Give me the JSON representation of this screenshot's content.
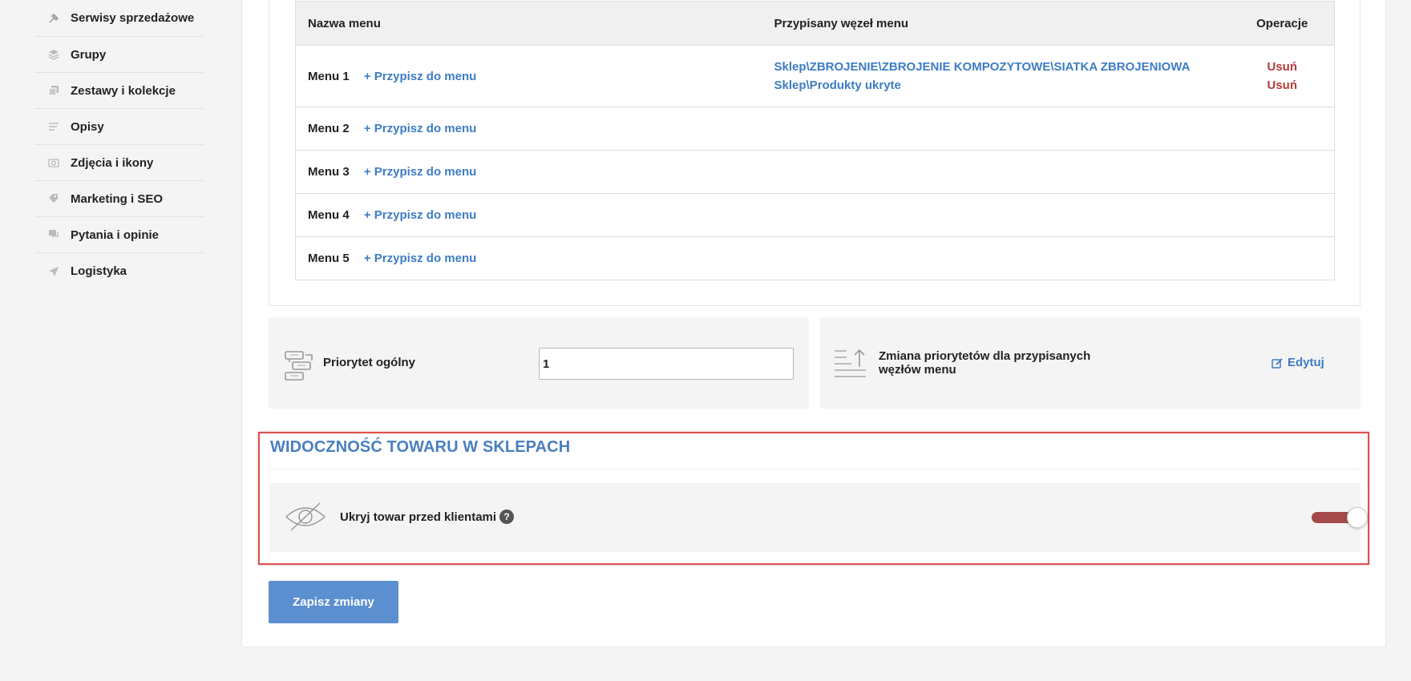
{
  "sidebar": {
    "items": [
      {
        "label": "Serwisy sprzedażowe",
        "icon": "hammer-icon"
      },
      {
        "label": "Grupy",
        "icon": "layers-icon"
      },
      {
        "label": "Zestawy i kolekcje",
        "icon": "stack-icon"
      },
      {
        "label": "Opisy",
        "icon": "text-icon"
      },
      {
        "label": "Zdjęcia i ikony",
        "icon": "camera-icon"
      },
      {
        "label": "Marketing i SEO",
        "icon": "tags-icon"
      },
      {
        "label": "Pytania i opinie",
        "icon": "comments-icon"
      },
      {
        "label": "Logistyka",
        "icon": "send-icon"
      }
    ]
  },
  "menu_table": {
    "headers": {
      "name": "Nazwa menu",
      "node": "Przypisany węzeł menu",
      "ops": "Operacje"
    },
    "rows": [
      {
        "name": "Menu 1",
        "assign": "+ Przypisz do menu",
        "nodes": [
          "Sklep\\ZBROJENIE\\ZBROJENIE KOMPOZYTOWE\\SIATKA ZBROJENIOWA",
          "Sklep\\Produkty ukryte"
        ],
        "ops": [
          "Usuń",
          "Usuń"
        ]
      },
      {
        "name": "Menu 2",
        "assign": "+ Przypisz do menu"
      },
      {
        "name": "Menu 3",
        "assign": "+ Przypisz do menu"
      },
      {
        "name": "Menu 4",
        "assign": "+ Przypisz do menu"
      },
      {
        "name": "Menu 5",
        "assign": "+ Przypisz do menu"
      }
    ]
  },
  "priority": {
    "label": "Priorytet ogólny",
    "value": "1",
    "change_label": "Zmiana priorytetów dla przypisanych węzłów menu",
    "edit_label": "Edytuj"
  },
  "visibility": {
    "title": "WIDOCZNOŚĆ TOWARU W SKLEPACH",
    "hide_label": "Ukryj towar przed klientami",
    "help": "?",
    "toggle_on": true
  },
  "save_label": "Zapisz zmiany",
  "colors": {
    "link": "#3d7cc4",
    "danger": "#b43a3a",
    "accent": "#5b8fcf",
    "highlight_border": "#d9534f"
  }
}
